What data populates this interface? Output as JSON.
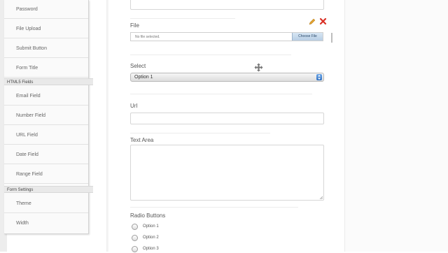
{
  "sidebar": {
    "items_top": [
      {
        "label": "Password"
      },
      {
        "label": "File Upload"
      },
      {
        "label": "Submit Button"
      },
      {
        "label": "Form Title"
      }
    ],
    "html5_header": "HTML5 Fields",
    "items_html5": [
      {
        "label": "Email Field"
      },
      {
        "label": "Number Field"
      },
      {
        "label": "URL Field"
      },
      {
        "label": "Date Field"
      },
      {
        "label": "Range Field"
      }
    ],
    "settings_header": "Form Settings",
    "items_settings": [
      {
        "label": "Theme"
      },
      {
        "label": "Width"
      }
    ]
  },
  "form": {
    "file": {
      "label": "File",
      "status_text": "No file selected.",
      "button_label": "Choose File"
    },
    "select": {
      "label": "Select",
      "selected": "Option 1"
    },
    "url": {
      "label": "Url"
    },
    "textarea": {
      "label": "Text Area"
    },
    "radio": {
      "label": "Radio Buttons",
      "options": [
        "Option 1",
        "Option 2",
        "Option 3"
      ]
    }
  },
  "icons": {
    "edit": "pencil-icon",
    "delete": "close-icon",
    "move": "move-icon"
  },
  "colors": {
    "delete_red": "#d93025",
    "pencil_orange": "#e0a030",
    "file_button": "#c7daef"
  }
}
